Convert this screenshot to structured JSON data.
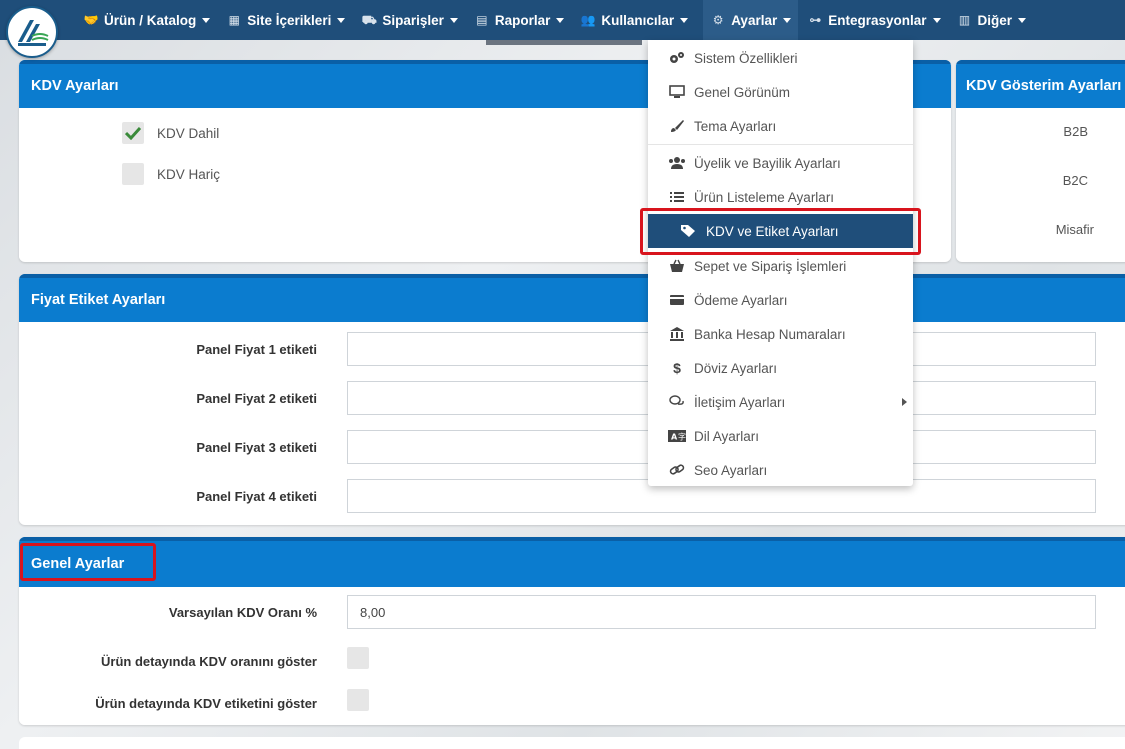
{
  "nav": {
    "items": [
      {
        "label": "Ürün / Katalog",
        "icon": "handshake-icon"
      },
      {
        "label": "Site İçerikleri",
        "icon": "grid-icon"
      },
      {
        "label": "Siparişler",
        "icon": "truck-icon"
      },
      {
        "label": "Raporlar",
        "icon": "file-icon"
      },
      {
        "label": "Kullanıcılar",
        "icon": "users-icon"
      },
      {
        "label": "Ayarlar",
        "icon": "gears-icon"
      },
      {
        "label": "Entegrasyonlar",
        "icon": "network-icon"
      },
      {
        "label": "Diğer",
        "icon": "building-icon"
      }
    ]
  },
  "kdv_panel": {
    "title": "KDV Ayarları",
    "options": [
      {
        "label": "KDV Dahil",
        "checked": true
      },
      {
        "label": "KDV Hariç",
        "checked": false
      }
    ]
  },
  "kdv_display_panel": {
    "title": "KDV Gösterim Ayarları",
    "rows": [
      "B2B",
      "B2C",
      "Misafir"
    ]
  },
  "price_label_panel": {
    "title": "Fiyat Etiket Ayarları",
    "fields": [
      {
        "label": "Panel Fiyat 1 etiketi",
        "value": ""
      },
      {
        "label": "Panel Fiyat 2 etiketi",
        "value": ""
      },
      {
        "label": "Panel Fiyat 3 etiketi",
        "value": ""
      },
      {
        "label": "Panel Fiyat 4 etiketi",
        "value": ""
      }
    ]
  },
  "general_panel": {
    "title": "Genel Ayarlar",
    "default_vat_label": "Varsayılan KDV Oranı %",
    "default_vat_value": "8,00",
    "show_vat_rate_label": "Ürün detayında KDV oranını göster",
    "show_vat_tag_label": "Ürün detayında KDV etiketini göster"
  },
  "dropdown": {
    "items": [
      {
        "label": "Sistem Özellikleri",
        "icon": "gears-icon"
      },
      {
        "label": "Genel Görünüm",
        "icon": "monitor-icon"
      },
      {
        "label": "Tema Ayarları",
        "icon": "brush-icon"
      },
      {
        "label": "Üyelik ve Bayilik Ayarları",
        "icon": "users-icon"
      },
      {
        "label": "Ürün Listeleme Ayarları",
        "icon": "list-icon"
      },
      {
        "label": "KDV ve Etiket Ayarları",
        "icon": "tags-icon"
      },
      {
        "label": "Sepet ve Sipariş İşlemleri",
        "icon": "basket-icon"
      },
      {
        "label": "Ödeme Ayarları",
        "icon": "credit-card-icon"
      },
      {
        "label": "Banka Hesap Numaraları",
        "icon": "bank-icon"
      },
      {
        "label": "Döviz Ayarları",
        "icon": "dollar-icon"
      },
      {
        "label": "İletişim Ayarları",
        "icon": "chat-icon"
      },
      {
        "label": "Dil Ayarları",
        "icon": "language-icon"
      },
      {
        "label": "Seo Ayarları",
        "icon": "link-icon"
      }
    ],
    "selected": "KDV ve Etiket Ayarları"
  },
  "colors": {
    "nav_bg": "#1f4e7a",
    "panel_header": "#0b7ccf",
    "highlight": "#d8141d",
    "check": "#3a8a3a"
  }
}
